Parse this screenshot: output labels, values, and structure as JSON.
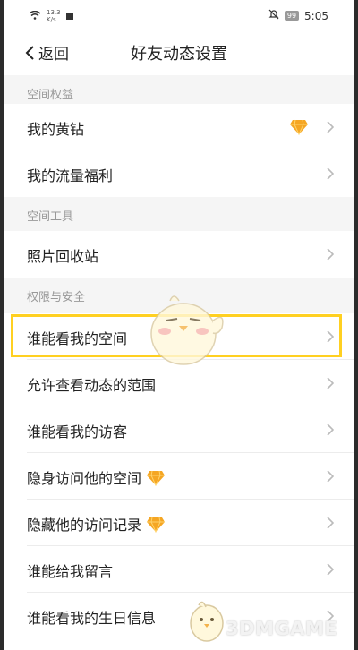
{
  "status_bar": {
    "speed": "13.3",
    "speed_unit": "K/s",
    "battery": "99",
    "time": "5:05"
  },
  "nav": {
    "back_label": "返回",
    "title": "好友动态设置"
  },
  "sections": {
    "space_rights": "空间权益",
    "space_tools": "空间工具",
    "permissions": "权限与安全"
  },
  "rows": {
    "yellow_diamond": "我的黄钻",
    "traffic_benefits": "我的流量福利",
    "photo_recycle": "照片回收站",
    "who_can_view_space": "谁能看我的空间",
    "allow_view_range": "允许查看动态的范围",
    "who_can_view_visitors": "谁能看我的访客",
    "invisible_visit": "隐身访问他的空间",
    "hide_visit_record": "隐藏他的访问记录",
    "who_can_leave_message": "谁能给我留言",
    "who_can_view_birthday": "谁能看我的生日信息"
  },
  "watermark": "3DMGAME",
  "colors": {
    "highlight": "#ffd021",
    "diamond": "#f5a623",
    "section_text": "#999999"
  }
}
